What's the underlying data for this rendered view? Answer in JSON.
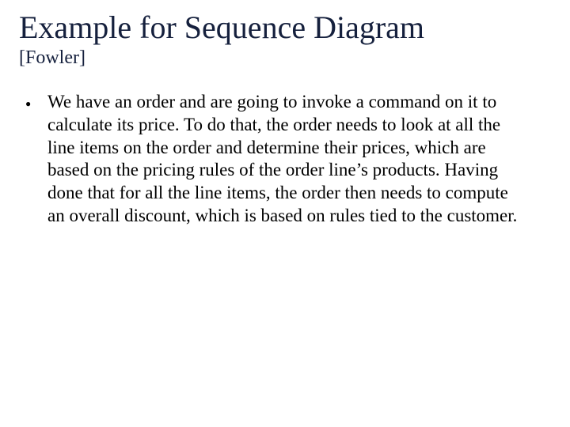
{
  "title": "Example for Sequence Diagram",
  "subtitle": "[Fowler]",
  "bullet_glyph": "●",
  "paragraph": "We have an order and are going to invoke a command on it to calculate its price.  To do that, the order needs to look at all the line items on the order and determine their prices, which are based on the pricing rules of the order line’s products.  Having done that for all the line items, the order then needs to compute an overall discount, which is based on rules tied to the customer."
}
